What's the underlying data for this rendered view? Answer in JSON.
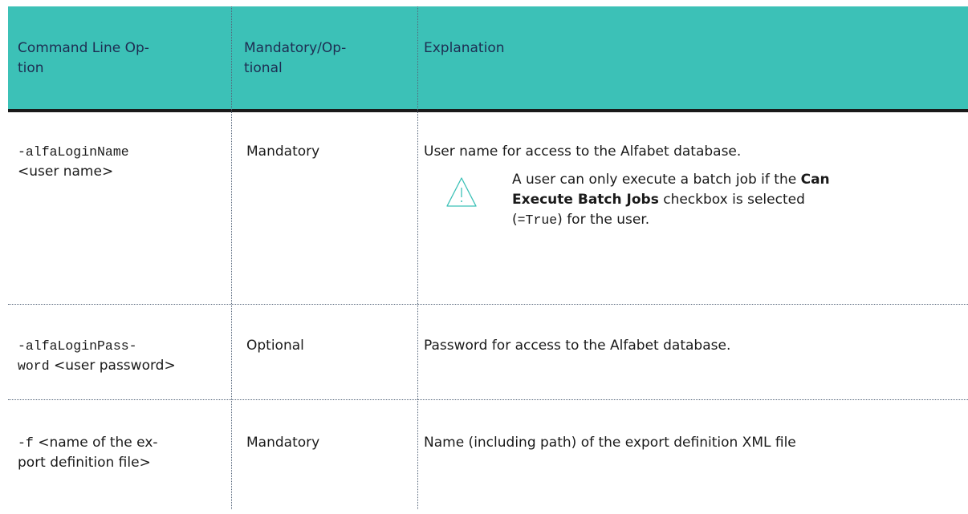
{
  "headers": {
    "col1_line1": "Command Line Op-",
    "col1_line2": "tion",
    "col2_line1": "Mandatory/Op-",
    "col2_line2": "tional",
    "col3": "Explanation"
  },
  "rows": [
    {
      "option_mono": "-alfaLoginName",
      "option_arg": "<user name>",
      "requirement": "Mandatory",
      "explanation": "User name for access to the Alfabet database.",
      "note": {
        "icon": "warning-triangle-icon",
        "part1": "A user can only execute a batch job if the ",
        "bold1": "Can",
        "bold2": "Execute Batch Jobs",
        "part2": " checkbox is selected",
        "part3_open": "(",
        "part3_mono": "=True",
        "part3_close": ") for the user."
      }
    },
    {
      "option_mono_line1": "-alfaLoginPass-",
      "option_mono_line2": "word",
      "option_arg": " <user password>",
      "requirement": "Optional",
      "explanation": "Password for access to the Alfabet database."
    },
    {
      "option_mono": "-f",
      "option_arg_line1": " <name of the ex-",
      "option_arg_line2": "port definition file>",
      "requirement": "Mandatory",
      "explanation": "Name (including path) of the export definition XML file"
    }
  ],
  "colors": {
    "header_bg": "#3cc1b7",
    "header_text": "#1e2d52",
    "rule": "#1a1a1a",
    "divider": "#55657a",
    "icon": "#3cc1b7"
  }
}
